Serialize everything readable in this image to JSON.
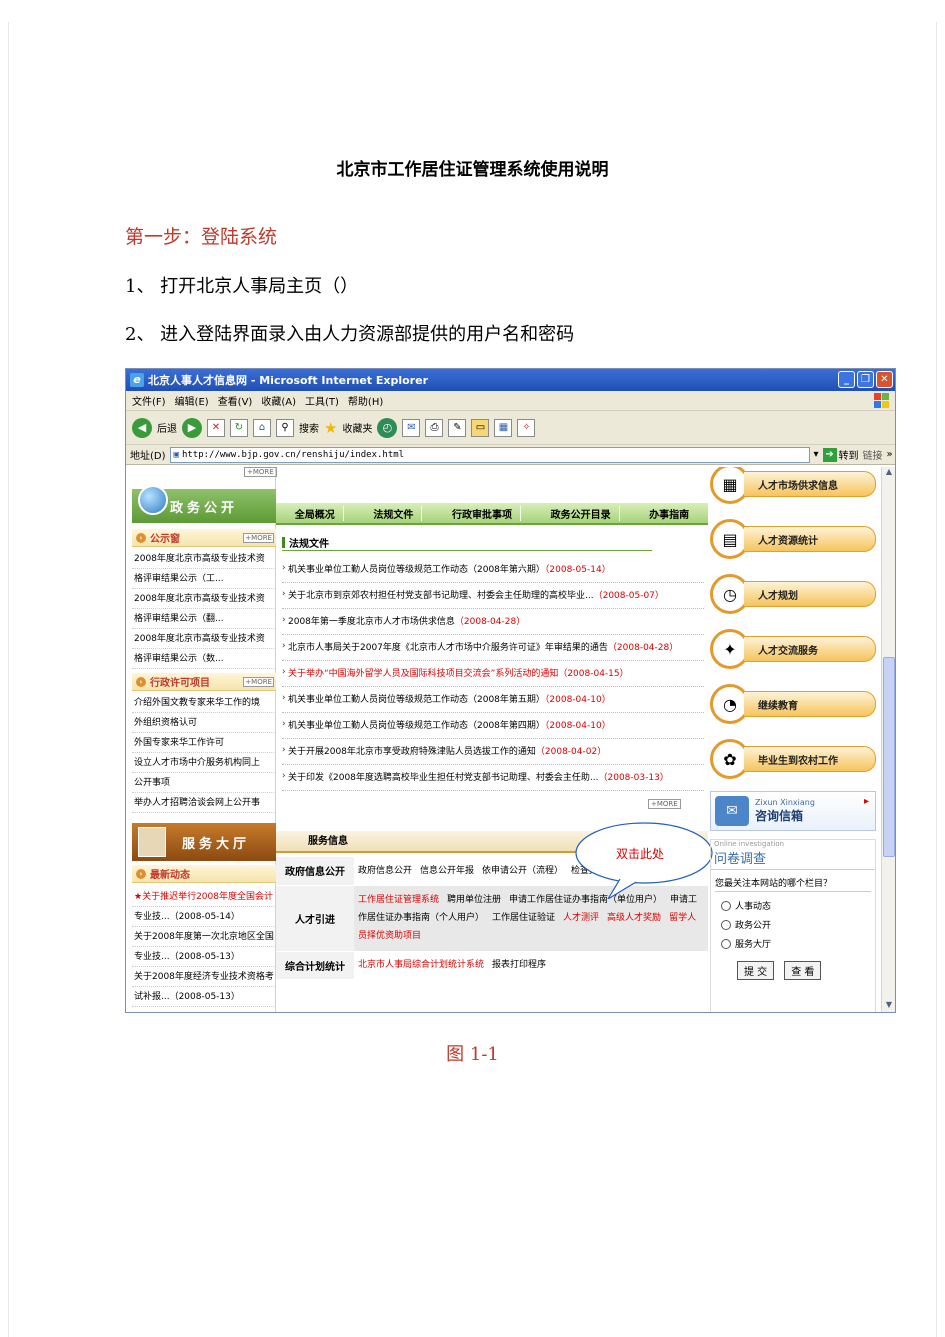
{
  "doc": {
    "title": "北京市工作居住证管理系统使用说明",
    "step_heading": "第一步：登陆系统",
    "paragraph1": "1、 打开北京人事局主页（）",
    "paragraph2": "2、 进入登陆界面录入由人力资源部提供的用户名和密码",
    "caption": "图 1-1"
  },
  "browser": {
    "window_title": "北京人事人才信息网 - Microsoft Internet Explorer",
    "menu": [
      "文件(F)",
      "编辑(E)",
      "查看(V)",
      "收藏(A)",
      "工具(T)",
      "帮助(H)"
    ],
    "toolbar": {
      "back": "后退",
      "search": "搜索",
      "favorites": "收藏夹"
    },
    "address_label": "地址(D)",
    "address_value": "http://www.bjp.gov.cn/renshiju/index.html",
    "go_label": "转到",
    "links_label": "链接"
  },
  "site": {
    "more": "+MORE",
    "gov_banner": "政务公开",
    "nav": [
      "全局概况",
      "法规文件",
      "行政审批事项",
      "政务公开目录",
      "办事指南"
    ],
    "notice": {
      "title": "公示窗",
      "items": [
        {
          "text": "2008年度北京市高级专业技术资",
          "red": false
        },
        {
          "text": "格评审结果公示（工...",
          "red": false
        },
        {
          "text": "2008年度北京市高级专业技术资",
          "red": false
        },
        {
          "text": "格评审结果公示（翻...",
          "red": false
        },
        {
          "text": "2008年度北京市高级专业技术资",
          "red": false
        },
        {
          "text": "格评审结果公示（数...",
          "red": false
        }
      ]
    },
    "admin": {
      "title": "行政许可项目",
      "items": [
        {
          "text": "介绍外国文教专家来华工作的境",
          "red": false
        },
        {
          "text": "外组织资格认可",
          "red": false
        },
        {
          "text": "外国专家来华工作许可",
          "red": false
        },
        {
          "text": "设立人才市场中介服务机构同上",
          "red": false
        },
        {
          "text": "公开事项",
          "red": false
        },
        {
          "text": "举办人才招聘洽谈会网上公开事",
          "red": false
        }
      ]
    },
    "service_banner": "服务大厅",
    "latest": {
      "title": "最新动态",
      "items": [
        {
          "text": "★关于推迟举行2008年度全国会计",
          "red": true
        },
        {
          "text": "专业技...（2008-05-14）",
          "red": false
        },
        {
          "text": "关于2008年度第一次北京地区全国",
          "red": false
        },
        {
          "text": "专业技...（2008-05-13）",
          "red": false
        },
        {
          "text": "关于2008年度经济专业技术资格考",
          "red": false
        },
        {
          "text": "试补报...（2008-05-13）",
          "red": false
        }
      ]
    },
    "law_title": "法规文件",
    "news": [
      {
        "text": "机关事业单位工勤人员岗位等级规范工作动态（2008年第六期）",
        "date": "（2008-05-14）",
        "hl": false
      },
      {
        "text": "关于北京市到京郊农村担任村党支部书记助理、村委会主任助理的高校毕业...",
        "date": "（2008-05-07）",
        "hl": false
      },
      {
        "text": "2008年第一季度北京市人才市场供求信息",
        "date": "（2008-04-28）",
        "hl": false
      },
      {
        "text": "北京市人事局关于2007年度《北京市人才市场中介服务许可证》年审结果的通告",
        "date": "（2008-04-28）",
        "hl": false
      },
      {
        "text": "关于举办“中国海外留学人员及国际科技项目交流会”系列活动的通知",
        "date": "（2008-04-15）",
        "hl": true
      },
      {
        "text": "机关事业单位工勤人员岗位等级规范工作动态（2008年第五期）",
        "date": "（2008-04-10）",
        "hl": false
      },
      {
        "text": "机关事业单位工勤人员岗位等级规范工作动态（2008年第四期）",
        "date": "（2008-04-10）",
        "hl": false
      },
      {
        "text": "关于开展2008年北京市享受政府特殊津贴人员选拔工作的通知",
        "date": "（2008-04-02）",
        "hl": false
      },
      {
        "text": "关于印发《2008年度选聘高校毕业生担任村党支部书记助理、村委会主任助...",
        "date": "（2008-03-13）",
        "hl": false
      }
    ],
    "service_info_title": "服务信息",
    "services": [
      {
        "category": "政府信息公开",
        "links": [
          {
            "text": "政府信息公开",
            "red": false
          },
          {
            "text": "信息公开年报",
            "red": false
          },
          {
            "text": "依申请公开（流程）",
            "red": false
          },
          {
            "text": "检查文件",
            "red": false
          }
        ]
      },
      {
        "category": "人才引进",
        "links": [
          {
            "text": "工作居住证管理系统",
            "red": true
          },
          {
            "text": "聘用单位注册",
            "red": false
          },
          {
            "text": "申请工作居住证办事指南（单位用户）",
            "red": false
          },
          {
            "text": "申请工作居住证办事指南（个人用户）",
            "red": false
          },
          {
            "text": "工作居住证验证",
            "red": false
          },
          {
            "text": "人才测评",
            "red": true
          },
          {
            "text": "高级人才奖励",
            "red": true
          },
          {
            "text": "留学人员择优资助项目",
            "red": true
          }
        ]
      },
      {
        "category": "综合计划统计",
        "links": [
          {
            "text": "北京市人事局综合计划统计系统",
            "red": true
          },
          {
            "text": "报表打印程序",
            "red": false
          }
        ]
      }
    ],
    "callout": "双击此处",
    "right_buttons": [
      {
        "label": "人才市场供求信息",
        "icon": "grid-icon",
        "glyph": "▦"
      },
      {
        "label": "人才资源统计",
        "icon": "chart-icon",
        "glyph": "▤"
      },
      {
        "label": "人才规划",
        "icon": "clock-icon",
        "glyph": "◷"
      },
      {
        "label": "人才交流服务",
        "icon": "handshake-icon",
        "glyph": "✦"
      },
      {
        "label": "继续教育",
        "icon": "pie-icon",
        "glyph": "◔"
      },
      {
        "label": "毕业生到农村工作",
        "icon": "person-icon",
        "glyph": "✿"
      }
    ],
    "zixun": {
      "en": "Zixun Xinxiang",
      "cn": "咨询信箱"
    },
    "survey": {
      "en": "Online investigation",
      "title": "问卷调查",
      "question": "您最关注本网站的哪个栏目？",
      "options": [
        "人事动态",
        "政务公开",
        "服务大厅"
      ],
      "submit": "提 交",
      "view": "查 看"
    }
  },
  "colors": {
    "heading_red": "#c0392b",
    "gov_green": "#5c9a35",
    "service_brown": "#8c4a12",
    "accent_orange": "#e49a2a"
  }
}
